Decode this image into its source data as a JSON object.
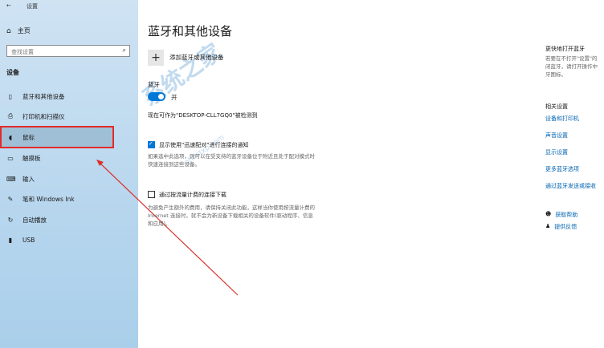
{
  "window": {
    "title": "设置"
  },
  "sidebar": {
    "home_label": "主页",
    "search_placeholder": "查找设置",
    "section_label": "设备",
    "items": [
      {
        "label": "蓝牙和其他设备",
        "icon": "bluetooth-icon"
      },
      {
        "label": "打印机和扫描仪",
        "icon": "printer-icon"
      },
      {
        "label": "鼠标",
        "icon": "mouse-icon"
      },
      {
        "label": "触摸板",
        "icon": "touchpad-icon"
      },
      {
        "label": "输入",
        "icon": "keyboard-icon"
      },
      {
        "label": "笔和 Windows Ink",
        "icon": "pen-icon"
      },
      {
        "label": "自动播放",
        "icon": "autoplay-icon"
      },
      {
        "label": "USB",
        "icon": "usb-icon"
      }
    ],
    "selected_index": 2
  },
  "main": {
    "title": "蓝牙和其他设备",
    "add_device_label": "添加蓝牙或其他设备",
    "bluetooth_label": "蓝牙",
    "toggle_state": "开",
    "discoverable_text": "现在可作为\"DESKTOP-CLL7GQ0\"被检测到",
    "swift_pair": {
      "checked": true,
      "label": "显示使用\"迅速配对\"进行连接的通知",
      "desc_line1": "如果选中此选项，则可以在受支持的蓝牙设备位于附近且处于配对模式时",
      "desc_line2": "快速连接到这些设备。"
    },
    "metered": {
      "checked": false,
      "label": "通过按流量计费的连接下载",
      "desc_line1": "为避免产生额外的费用，请保持关闭此功能，这样当你使用按流量计费的",
      "desc_line2": "Internet 连接时，就不会为新设备下载相关的设备软件(驱动程序、信息",
      "desc_line3": "和应用)。"
    }
  },
  "right_panel": {
    "quick_title": "更快地打开蓝牙",
    "quick_desc_1": "若要在不打开\"设置\"的",
    "quick_desc_2": "闭蓝牙，请打开操作中",
    "quick_desc_3": "牙图标。",
    "related_title": "相关设置",
    "links": [
      "设备和打印机",
      "声音设置",
      "显示设置",
      "更多蓝牙选项",
      "通过蓝牙发送或接收"
    ],
    "help": "获取帮助",
    "feedback": "提供反馈"
  },
  "watermark": {
    "text": "系统之家",
    "url": "ghostxp.com"
  }
}
